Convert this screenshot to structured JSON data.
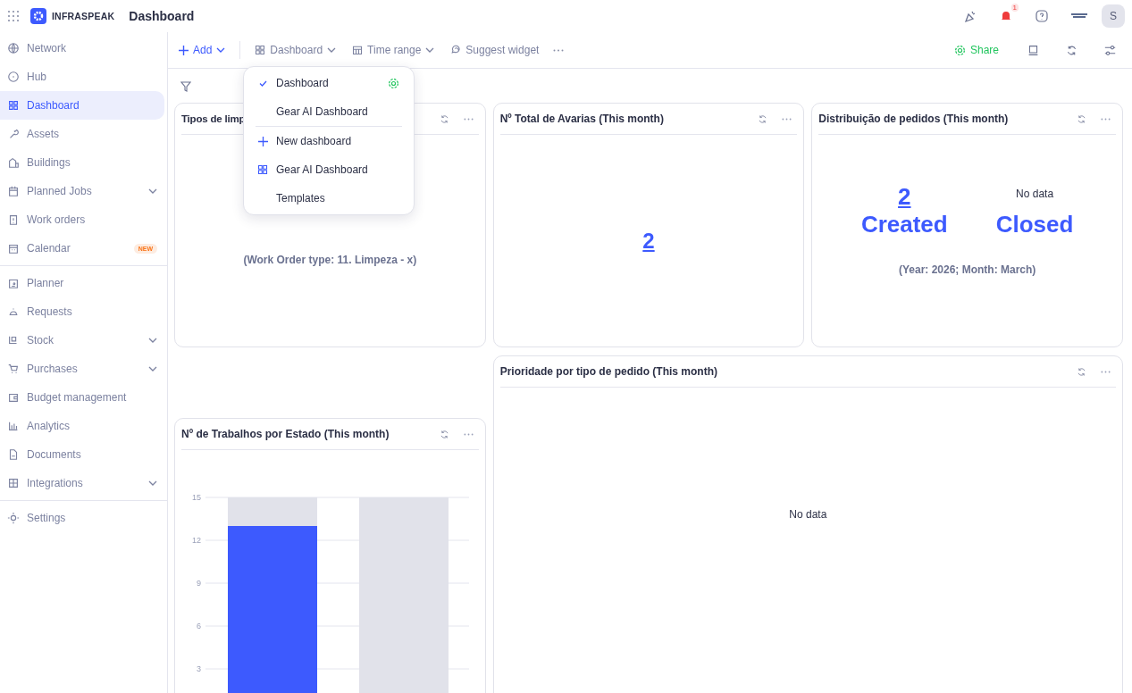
{
  "header": {
    "brand": "INFRASPEAK",
    "title": "Dashboard",
    "notification_count": "1",
    "avatar": "S"
  },
  "sidebar": {
    "sections": [
      [
        {
          "label": "Network",
          "selected": false,
          "chevron": false
        },
        {
          "label": "Hub",
          "selected": false,
          "chevron": false
        },
        {
          "label": "Dashboard",
          "selected": true,
          "chevron": false
        },
        {
          "label": "Assets",
          "selected": false,
          "chevron": false
        },
        {
          "label": "Buildings",
          "selected": false,
          "chevron": false
        },
        {
          "label": "Planned Jobs",
          "selected": false,
          "chevron": true
        },
        {
          "label": "Work orders",
          "selected": false,
          "chevron": false
        },
        {
          "label": "Calendar",
          "selected": false,
          "chevron": false,
          "badge": "NEW"
        }
      ],
      [
        {
          "label": "Planner",
          "selected": false,
          "chevron": false
        },
        {
          "label": "Requests",
          "selected": false,
          "chevron": false
        },
        {
          "label": "Stock",
          "selected": false,
          "chevron": true
        },
        {
          "label": "Purchases",
          "selected": false,
          "chevron": true
        },
        {
          "label": "Budget management",
          "selected": false,
          "chevron": false
        },
        {
          "label": "Analytics",
          "selected": false,
          "chevron": false
        },
        {
          "label": "Documents",
          "selected": false,
          "chevron": false
        },
        {
          "label": "Integrations",
          "selected": false,
          "chevron": true
        }
      ],
      [
        {
          "label": "Settings",
          "selected": false,
          "chevron": false
        }
      ]
    ]
  },
  "toolbar": {
    "add": "Add",
    "dashboard": "Dashboard",
    "time_range": "Time range",
    "suggest": "Suggest widget",
    "share": "Share"
  },
  "dashboard_menu": {
    "dashboards": [
      {
        "label": "Dashboard",
        "selected": true,
        "shared": true
      },
      {
        "label": "Gear AI Dashboard",
        "selected": false,
        "shared": false
      }
    ],
    "actions": [
      {
        "label": "New dashboard",
        "kind": "plus"
      },
      {
        "label": "Gear AI Dashboard",
        "kind": "grid"
      },
      {
        "label": "Templates",
        "kind": "plain"
      }
    ]
  },
  "widgets": [
    {
      "kind": "number",
      "title": "Tipos de limp",
      "caption": "(Work Order type: 11. Limpeza - x)"
    },
    {
      "kind": "number",
      "title": "Nº Total de Avarias (This month)",
      "value": "2"
    },
    {
      "kind": "distribution",
      "title": "Distribuição de pedidos (This month)",
      "columns": [
        {
          "value": "2",
          "label": "Created"
        },
        {
          "empty": "No data",
          "label": "Closed"
        }
      ],
      "caption": "(Year: 2026; Month: March)"
    },
    {
      "kind": "chart",
      "title": "Nº de Trabalhos por Estado (This month)",
      "chart_data": {
        "type": "bar",
        "stacked": true,
        "grid": true,
        "ylim": [
          0,
          15
        ],
        "yticks": [
          3,
          6,
          9,
          12,
          15
        ],
        "series": [
          {
            "color": "#3d5afe",
            "values": [
              13,
              0
            ]
          },
          {
            "color": "#e1e2ea",
            "values": [
              2,
              15
            ]
          }
        ]
      }
    },
    {
      "kind": "empty",
      "title": "Prioridade por tipo de pedido (This month)",
      "empty": "No data"
    }
  ]
}
